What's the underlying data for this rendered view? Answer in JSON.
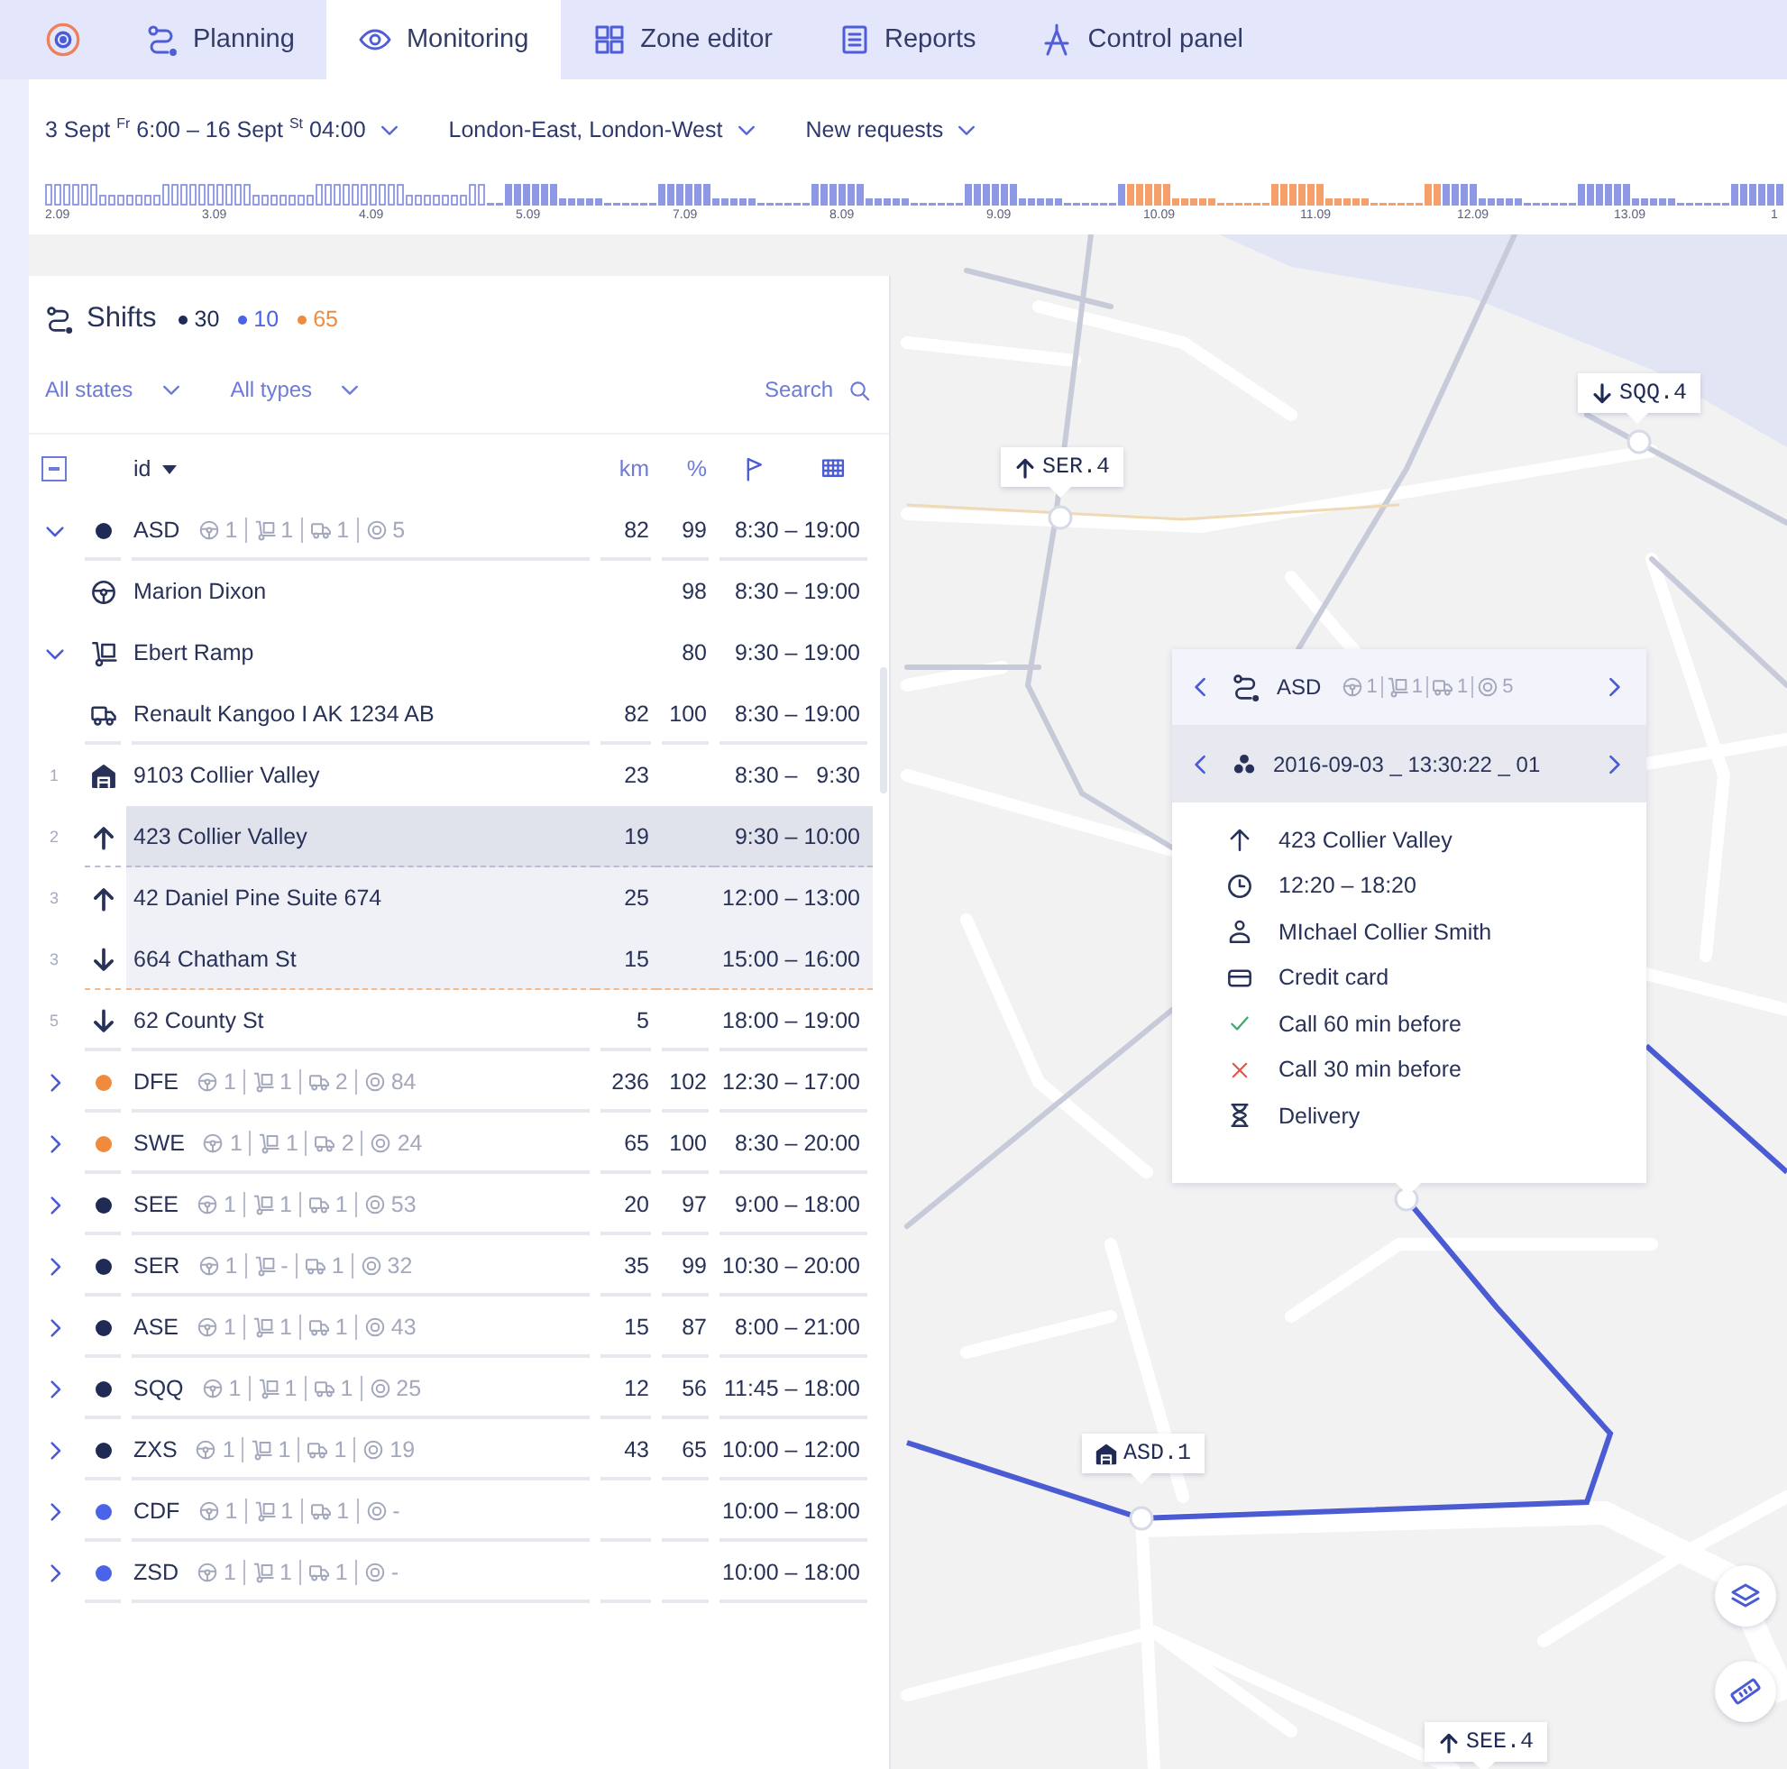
{
  "nav": {
    "tabs": [
      {
        "label": "Planning",
        "selected": false
      },
      {
        "label": "Monitoring",
        "selected": true
      },
      {
        "label": "Zone editor",
        "selected": false
      },
      {
        "label": "Reports",
        "selected": false
      },
      {
        "label": "Control panel",
        "selected": false
      }
    ]
  },
  "filters": [
    {
      "label": "3 Sept $^{Fr}$ 6:00 – 16 Sept $^{St}$ 04:00"
    },
    {
      "label": "London-East, London-West"
    },
    {
      "label": "New requests"
    }
  ],
  "timeline": {
    "labels": [
      "2.09",
      "3.09",
      "4.09",
      "5.09",
      "7.09",
      "8.09",
      "9.09",
      "10.09",
      "11.09",
      "12.09",
      "13.09",
      "1"
    ]
  },
  "shifts_panel": {
    "title": "Shifts",
    "totals": [
      {
        "count": "30",
        "color": "#1f2a55"
      },
      {
        "count": "10",
        "color": "#4a63e8"
      },
      {
        "count": "65",
        "color": "#f08a3c"
      }
    ],
    "state_filter": "All states",
    "type_filter": "All types",
    "search": "Search",
    "select_all": {
      "partial": true
    },
    "columns": [
      {
        "label": "id",
        "sorted": true
      },
      {
        "label": "km"
      },
      {
        "label": "%"
      }
    ],
    "shifts": [
      {
        "kind": "shift",
        "id": "ASD",
        "color": "#1f2a55",
        "expanded": true,
        "counts": [
          "1",
          "1",
          "1",
          "5"
        ],
        "km": "82",
        "pct": "99",
        "time": "8:30 – 19:00",
        "children": [
          {
            "kind": "driver",
            "name": "Marion Dixon",
            "pct": "98",
            "time": "8:30 – 19:00"
          },
          {
            "kind": "courier",
            "name": "Ebert Ramp",
            "expanded": true,
            "pct": "80",
            "time": "9:30 – 19:00",
            "children": [
              {
                "kind": "vehicle",
                "name": "Renault Kangoo I AK 1234 AB",
                "km": "82",
                "pct": "100",
                "time": "8:30 – 19:00"
              },
              {
                "kind": "depot",
                "number": "1",
                "name": "9103 Collier Valley",
                "km": "23",
                "time": "8:30 –   9:30",
                "selected": false,
                "highlighted": false
              },
              {
                "kind": "pickup",
                "number": "2",
                "name": "423 Collier Valley",
                "km": "19",
                "time": "9:30 – 10:00",
                "selected": true,
                "highlighted": true
              },
              {
                "kind": "pickup",
                "number": "3",
                "name": "42 Daniel Pine Suite 674",
                "km": "25",
                "time": "12:00 – 13:00",
                "selected": false,
                "highlighted": true
              },
              {
                "kind": "dropoff",
                "number": "3",
                "name": "664 Chatham St",
                "km": "15",
                "time": "15:00 – 16:00",
                "selected": false,
                "highlighted": true
              },
              {
                "kind": "dropoff",
                "number": "5",
                "name": "62 County St",
                "km": "5",
                "time": "18:00 – 19:00",
                "selected": false,
                "highlighted": false
              }
            ]
          }
        ]
      },
      {
        "kind": "shift",
        "id": "DFE",
        "color": "#f08a3c",
        "expanded": false,
        "counts": [
          "1",
          "1",
          "2",
          "84"
        ],
        "km": "236",
        "pct": "102",
        "time": "12:30 – 17:00"
      },
      {
        "kind": "shift",
        "id": "SWE",
        "color": "#f08a3c",
        "expanded": false,
        "counts": [
          "1",
          "1",
          "2",
          "24"
        ],
        "km": "65",
        "pct": "100",
        "time": "8:30 – 20:00"
      },
      {
        "kind": "shift",
        "id": "SEE",
        "color": "#1f2a55",
        "expanded": false,
        "counts": [
          "1",
          "1",
          "1",
          "53"
        ],
        "km": "20",
        "pct": "97",
        "time": "9:00 – 18:00"
      },
      {
        "kind": "shift",
        "id": "SER",
        "color": "#1f2a55",
        "expanded": false,
        "counts": [
          "1",
          "-",
          "1",
          "32"
        ],
        "km": "35",
        "pct": "99",
        "time": "10:30 – 20:00"
      },
      {
        "kind": "shift",
        "id": "ASE",
        "color": "#1f2a55",
        "expanded": false,
        "counts": [
          "1",
          "1",
          "1",
          "43"
        ],
        "km": "15",
        "pct": "87",
        "time": "8:00 – 21:00"
      },
      {
        "kind": "shift",
        "id": "SQQ",
        "color": "#1f2a55",
        "expanded": false,
        "counts": [
          "1",
          "1",
          "1",
          "25"
        ],
        "km": "12",
        "pct": "56",
        "time": "11:45 – 18:00"
      },
      {
        "kind": "shift",
        "id": "ZXS",
        "color": "#1f2a55",
        "expanded": false,
        "counts": [
          "1",
          "1",
          "1",
          "19"
        ],
        "km": "43",
        "pct": "65",
        "time": "10:00 – 12:00"
      },
      {
        "kind": "shift",
        "id": "CDF",
        "color": "#4a63e8",
        "expanded": false,
        "counts": [
          "1",
          "1",
          "1",
          "-"
        ],
        "time": "10:00 – 18:00"
      },
      {
        "kind": "shift",
        "id": "ZSD",
        "color": "#4a63e8",
        "expanded": false,
        "counts": [
          "1",
          "1",
          "1",
          "-"
        ],
        "time": "10:00 – 18:00"
      }
    ]
  },
  "map": {
    "markers": [
      {
        "kind": "pickup",
        "label": "SER.4"
      },
      {
        "kind": "dropoff",
        "label": "SQQ.4"
      },
      {
        "kind": "depot",
        "label": "ASD.1"
      },
      {
        "kind": "pickup",
        "label": "SEE.4"
      }
    ],
    "popup": {
      "shift": {
        "id": "ASD",
        "counts": [
          "1",
          "1",
          "1",
          "5"
        ]
      },
      "order": "2016-09-03 _ 13:30:22 _ 01",
      "details": [
        {
          "kind": "address",
          "text": "423 Collier Valley"
        },
        {
          "kind": "time",
          "text": "12:20 – 18:20"
        },
        {
          "kind": "person",
          "text": "MIchael Collier Smith"
        },
        {
          "kind": "payment",
          "text": "Credit card"
        },
        {
          "kind": "call",
          "checked": true,
          "text": "Call 60 min before"
        },
        {
          "kind": "call",
          "checked": false,
          "text": "Call 30 min before"
        },
        {
          "kind": "order_type",
          "text": "Delivery"
        }
      ]
    }
  }
}
